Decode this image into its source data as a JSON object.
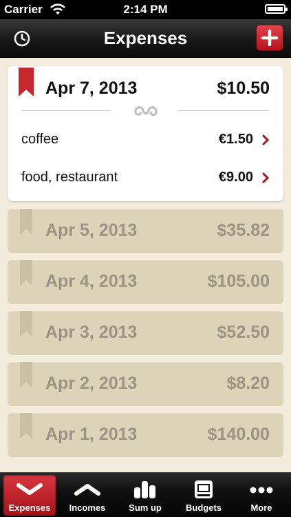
{
  "status_bar": {
    "carrier": "Carrier",
    "time": "2:14 PM"
  },
  "nav": {
    "title": "Expenses",
    "history_icon": "clock-icon",
    "add_icon": "plus-icon"
  },
  "expanded_day": {
    "date": "Apr 7, 2013",
    "total": "$10.50",
    "entries": [
      {
        "label": "coffee",
        "amount": "€1.50"
      },
      {
        "label": "food, restaurant",
        "amount": "€9.00"
      }
    ]
  },
  "days": [
    {
      "date": "Apr 5, 2013",
      "total": "$35.82"
    },
    {
      "date": "Apr 4, 2013",
      "total": "$105.00"
    },
    {
      "date": "Apr 3, 2013",
      "total": "$52.50"
    },
    {
      "date": "Apr 2, 2013",
      "total": "$8.20"
    },
    {
      "date": "Apr 1, 2013",
      "total": "$140.00"
    }
  ],
  "tabs": [
    {
      "label": "Expenses",
      "icon": "chevron-down-icon",
      "active": true
    },
    {
      "label": "Incomes",
      "icon": "chevron-up-icon",
      "active": false
    },
    {
      "label": "Sum up",
      "icon": "bar-chart-icon",
      "active": false
    },
    {
      "label": "Budgets",
      "icon": "budget-icon",
      "active": false
    },
    {
      "label": "More",
      "icon": "more-dots-icon",
      "active": false
    }
  ],
  "colors": {
    "accent": "#c8262e",
    "background": "#f3ecdc",
    "collapsed_row": "#ddd3b9",
    "muted_text": "#9b9482"
  }
}
